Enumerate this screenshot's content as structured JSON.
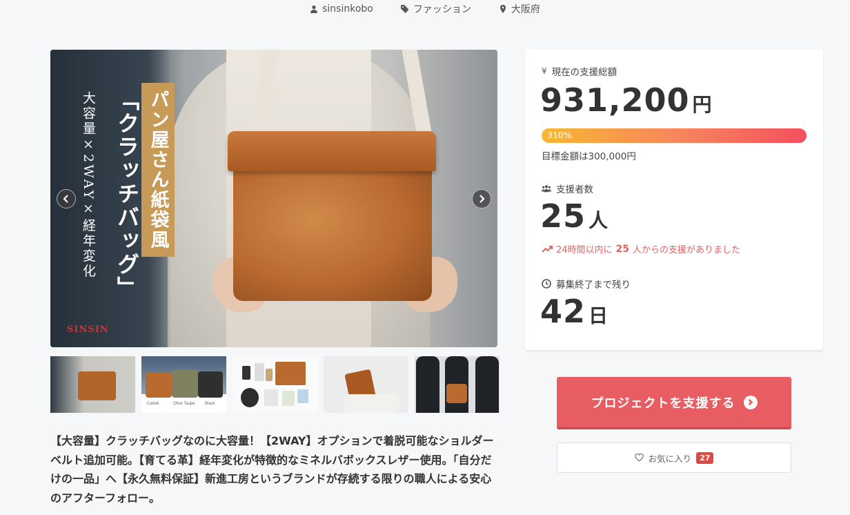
{
  "meta": {
    "owner": "sinsinkobo",
    "category": "ファッション",
    "location": "大阪府"
  },
  "hero": {
    "ribbon_text": "パン屋さん紙袋風",
    "big_text": "「クラッチバッグ」",
    "small_text": "大容量×2WAY×経年変化",
    "logo_text": "SINSIN"
  },
  "thumbnails": {
    "colors": [
      "Camel",
      "Olive Taupe",
      "Black"
    ]
  },
  "description": "【大容量】クラッチバッグなのに大容量！【2WAY】オプションで着脱可能なショルダーベルト追加可能。【育てる革】経年変化が特徴的なミネルバボックスレザー使用。「自分だけの一品」へ【永久無料保証】新進工房というブランドが存続する限りの職人による安心のアフターフォロー。",
  "stats": {
    "total_label": "現在の支援総額",
    "total_amount": "931,200",
    "total_unit": "円",
    "progress_percent": 310,
    "progress_text": "310%",
    "goal_text": "目標金額は300,000円",
    "backers_label": "支援者数",
    "backers_count": "25",
    "backers_unit": "人",
    "trend_prefix": "24時間以内に",
    "trend_count": "25",
    "trend_suffix": "人からの支援がありました",
    "remaining_label": "募集終了まで残り",
    "remaining_days": "42",
    "remaining_unit": "日"
  },
  "actions": {
    "support_label": "プロジェクトを支援する",
    "favorite_label": "お気に入り",
    "favorite_count": "27"
  },
  "colors": {
    "accent": "#e85d62",
    "progress_start": "#f7b733",
    "progress_end": "#f4505f",
    "trend": "#e06262"
  }
}
